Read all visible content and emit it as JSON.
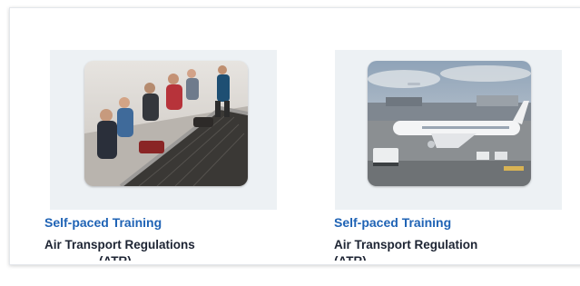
{
  "cards": [
    {
      "tag": "Self-paced Training",
      "title": "Air Transport Regulations",
      "title_overflow": "(ATR)",
      "image_icon": "baggage-carousel-photo"
    },
    {
      "tag": "Self-paced Training",
      "title": "Air Transport Regulation",
      "title_overflow": "(ATR)",
      "image_icon": "airplane-apron-photo"
    }
  ],
  "colors": {
    "tag": "#1f63b5",
    "title": "#1d2433",
    "card_bg": "#edf1f4"
  }
}
